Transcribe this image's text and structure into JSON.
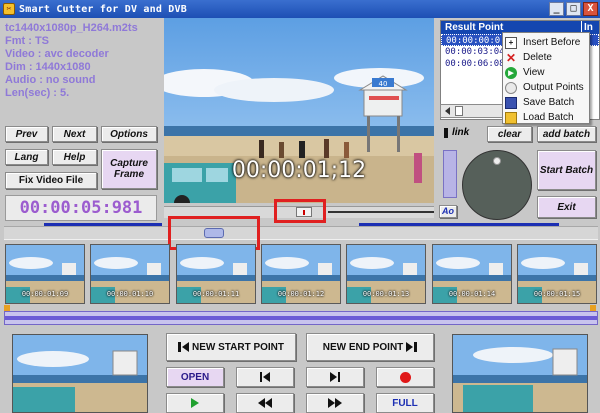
{
  "window": {
    "title": "Smart Cutter for DV and DVB",
    "minimize": "_",
    "maximize": "□",
    "close": "X"
  },
  "info": {
    "file": "tc1440x1080p_H264.m2ts",
    "fmt": "Fmt : TS",
    "video": "Video : avc decoder",
    "dim": "Dim : 1440x1080",
    "audio": "Audio : no sound",
    "len": "Len(sec) : 5."
  },
  "buttons": {
    "prev": "Prev",
    "next": "Next",
    "options": "Options",
    "lang": "Lang",
    "help": "Help",
    "capture_frame": "Capture Frame",
    "fix_video_file": "Fix Video File",
    "link": "link",
    "clear": "clear",
    "add_batch": "add batch",
    "start_batch": "Start Batch",
    "exit": "Exit",
    "ao": "Ao",
    "new_start_point": "NEW START POINT",
    "new_end_point": "NEW END POINT",
    "open": "OPEN",
    "full": "FULL"
  },
  "time_display": "00:00:05:981",
  "video_timecode": "00:00:01;12",
  "result_panel": {
    "header": "Result Point",
    "header_col2": "In",
    "rows": [
      "00:00:00:0",
      "00:00:03:04",
      "00:00:06:08"
    ]
  },
  "context_menu": {
    "items": [
      {
        "label": "Insert Before",
        "icon": "insert-icon"
      },
      {
        "label": "Delete",
        "icon": "delete-icon"
      },
      {
        "label": "View",
        "icon": "view-icon"
      },
      {
        "label": "Output Points",
        "icon": "output-icon"
      },
      {
        "label": "Save Batch",
        "icon": "save-icon"
      },
      {
        "label": "Load Batch",
        "icon": "load-icon"
      }
    ]
  },
  "thumbnails": [
    "00:00:01:09",
    "00:00:01:10",
    "00:00:01:11",
    "00:00:01:12",
    "00:00:01:13",
    "00:00:01:14",
    "00:00:01:15"
  ],
  "colors": {
    "accent_blue": "#1c2fb3",
    "info_text": "#8f79d8",
    "time_text": "#9c5ccf",
    "highlight_red": "#e02020"
  }
}
